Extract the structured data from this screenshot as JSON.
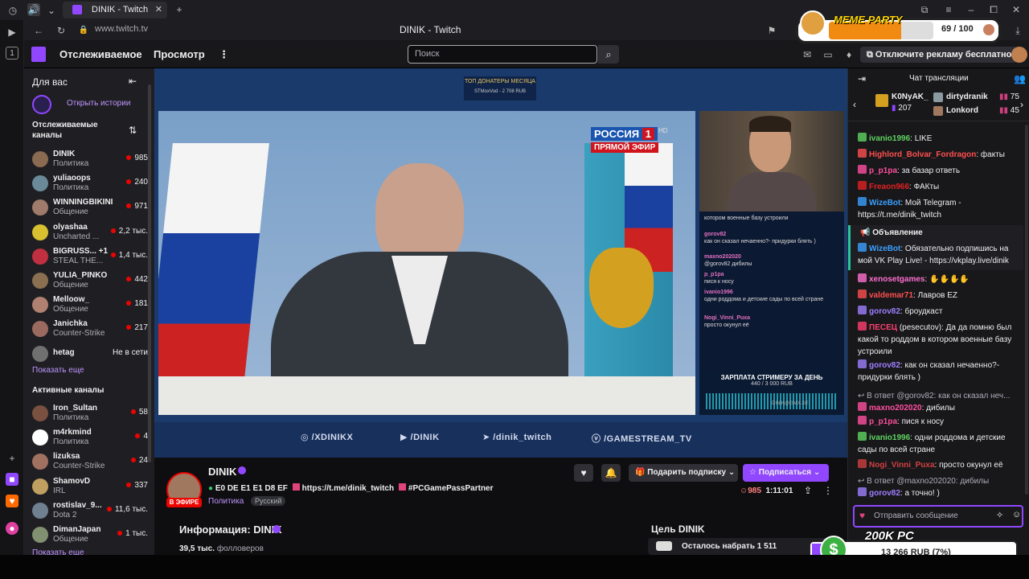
{
  "browser": {
    "tab_title": "DINIK - Twitch",
    "url": "www.twitch.tv",
    "window_title": "DINIK - Twitch"
  },
  "nav": {
    "following": "Отслеживаемое",
    "browse": "Просмотр",
    "search_placeholder": "Поиск",
    "ad_free": "Отключите рекламу бесплатно"
  },
  "sidebar": {
    "for_you": "Для вас",
    "open_stories": "Открыть истории",
    "followed_channels": "Отслеживаемые каналы",
    "show_more": "Показать еще",
    "active_channels": "Активные каналы",
    "show_more_2": "Показать еще",
    "followed": [
      {
        "name": "DINIK",
        "category": "Политика",
        "viewers": "985",
        "color": "#8a6a50"
      },
      {
        "name": "yuliaoops",
        "category": "Политика",
        "viewers": "240",
        "color": "#6a8a9a"
      },
      {
        "name": "WINNINGBIKINI",
        "category": "Общение",
        "viewers": "971",
        "color": "#a07a6a"
      },
      {
        "name": "olyashaa",
        "category": "Uncharted ...",
        "viewers": "2,2 тыс.",
        "color": "#d8c030"
      },
      {
        "name": "BIGRUSS... +1",
        "category": "STEAL THE...",
        "viewers": "1,4 тыс.",
        "color": "#c03040"
      },
      {
        "name": "YULIA_PINKO",
        "category": "Общение",
        "viewers": "442",
        "color": "#8a7050"
      },
      {
        "name": "Melloow_",
        "category": "Общение",
        "viewers": "181",
        "color": "#b08070"
      },
      {
        "name": "Janichka",
        "category": "Counter-Strike",
        "viewers": "217",
        "color": "#9a6a60"
      },
      {
        "name": "hetag",
        "category": "",
        "viewers": "Не в сети",
        "color": "#707070"
      }
    ],
    "active": [
      {
        "name": "Iron_Sultan",
        "category": "Политика",
        "viewers": "58",
        "color": "#7a5040"
      },
      {
        "name": "m4rkmind",
        "category": "Политика",
        "viewers": "4",
        "color": "#ffffff"
      },
      {
        "name": "lizuksa",
        "category": "Counter-Strike",
        "viewers": "24",
        "color": "#a07060"
      },
      {
        "name": "ShamovD",
        "category": "IRL",
        "viewers": "337",
        "color": "#c0a060"
      },
      {
        "name": "rostislav_9...",
        "category": "Dota 2",
        "viewers": "11,6 тыс.",
        "color": "#708090"
      },
      {
        "name": "DimanJapan",
        "category": "Общение",
        "viewers": "1 тыс.",
        "color": "#809070"
      }
    ]
  },
  "player": {
    "top_donors": "ТОП ДОНАТЕРЫ МЕСЯЦА",
    "top_donor_line": "STMoxVod - 2 708 RUB",
    "tv_channel": "РОССИЯ",
    "tv_number": "1",
    "tv_live": "ПРЯМОЙ ЭФИР",
    "tv_hd": "HD",
    "overlay_chat": [
      {
        "user": "",
        "text": "котором военные базу устроили"
      },
      {
        "user": "gorov82",
        "text": "как он сказал нечаенно?- придурки блять )"
      },
      {
        "user": "maxno202020",
        "text": "@gorov82 дибилы"
      },
      {
        "user": "p_p1pa",
        "text": "пися к носу"
      },
      {
        "user": "ivanio1996",
        "text": "одни роддома и детские сады по всей стране"
      },
      {
        "user": "Nogi_Vinni_Puxa",
        "text": "просто окунул её"
      }
    ],
    "salary_title": "ЗАРПЛАТА СТРИМЕРУ ЗА ДЕНЬ",
    "salary_value": "440 / 3 000 RUB",
    "salary_site": "DINIK@GMX.DE",
    "socials": [
      "/XDINIKX",
      "/DINIK",
      "/dinik_twitch",
      "/GAMESTREAM_TV"
    ]
  },
  "stream": {
    "name": "DINIK",
    "live_badge": "В ЭФИРЕ",
    "title_code": "E0 DE E1 E1 D8 EF",
    "title_link": "https://t.me/dinik_twitch",
    "title_tag": "#PCGamePassPartner",
    "category": "Политика",
    "language": "Русский",
    "gift_sub": "Подарить подписку",
    "subscribe": "Подписаться",
    "viewers": "985",
    "uptime": "1:11:01",
    "about": "Информация: DINIK",
    "followers": "39,5 тыс.",
    "followers_label": "фолловеров",
    "goal_title": "Цель DINIK",
    "goal_text": "Осталось набрать 1 511"
  },
  "chat": {
    "title": "Чат трансляции",
    "leaders": [
      {
        "name": "K0NyAK_",
        "value": "207"
      },
      {
        "name": "dirtydranik",
        "value": "75"
      },
      {
        "name": "Lonkord",
        "value": "45"
      }
    ],
    "announcement": "Объявление",
    "input_placeholder": "Отправить сообщение",
    "messages": [
      {
        "user": "ivanio1996",
        "color": "#5fd35f",
        "text": ": LIKE",
        "reply": ""
      },
      {
        "user": "Highlord_Bolvar_Fordragon",
        "color": "#ff4f4f",
        "text": ": факты",
        "reply": ""
      },
      {
        "user": "p_p1pa",
        "color": "#ff4f9f",
        "text": ": за базар ответь",
        "reply": ""
      },
      {
        "user": "Freaon966",
        "color": "#e02020",
        "text": ": ФАКты",
        "reply": ""
      },
      {
        "user": "WizeBot",
        "color": "#3aa0ff",
        "text": ": Мой Telegram - https://t.me/dinik_twitch",
        "reply": ""
      },
      {
        "user": "WizeBot",
        "color": "#3aa0ff",
        "text": ": Обязательно подпишись на мой VK Play Live! - https://vkplay.live/dinik",
        "reply": ""
      },
      {
        "user": "xenosetgames",
        "color": "#ff6fd0",
        "text": ":",
        "reply": ""
      },
      {
        "user": "valdemar71",
        "color": "#ff4f4f",
        "text": ": Лавров EZ",
        "reply": ""
      },
      {
        "user": "gorov82",
        "color": "#9f7fff",
        "text": ": броудкаст",
        "reply": ""
      },
      {
        "user": "ПЕСЕЦ",
        "color": "#ff3f6f",
        "text": " (pesecutov): Да да помню был какой то роддом в котором военные базу устроили",
        "reply": ""
      },
      {
        "user": "gorov82",
        "color": "#9f7fff",
        "text": ": как он сказал нечаенно?- придурки блять )",
        "reply": ""
      },
      {
        "user": "maxno202020",
        "color": "#ff4f9f",
        "text": ": дибилы",
        "reply": "В ответ @gorov82: как он сказал неч..."
      },
      {
        "user": "p_p1pa",
        "color": "#ff4f9f",
        "text": ": пися к носу",
        "reply": ""
      },
      {
        "user": "ivanio1996",
        "color": "#5fd35f",
        "text": ": одни роддома и детские сады по всей стране",
        "reply": ""
      },
      {
        "user": "Nogi_Vinni_Puxa",
        "color": "#d04040",
        "text": ": просто окунул её",
        "reply": ""
      },
      {
        "user": "gorov82",
        "color": "#9f7fff",
        "text": ": а точно! )",
        "reply": "В ответ @maxno202020: дибилы"
      }
    ]
  },
  "overlays": {
    "meme_title": "MEME PARTY",
    "meme_progress": "69 / 100",
    "meme_fraction": 0.69,
    "goal_title": "200K PC",
    "goal_value": "13 266 RUB (7%)"
  },
  "colors": {
    "twitch_purple": "#9147ff",
    "live_red": "#eb0400",
    "bg": "#0e0e10"
  }
}
